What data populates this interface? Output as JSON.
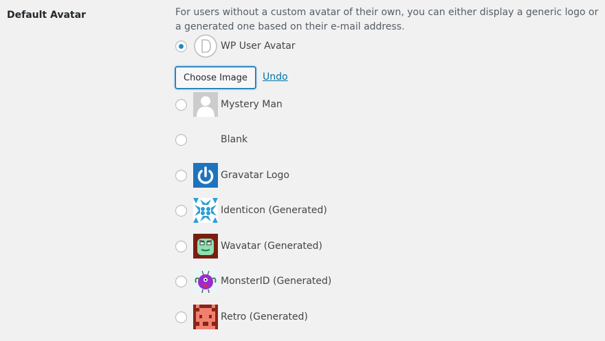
{
  "setting": {
    "label": "Default Avatar",
    "description": "For users without a custom avatar of their own, you can either display a generic logo or a generated one based on their e-mail address."
  },
  "actions": {
    "choose_image": "Choose Image",
    "undo": "Undo"
  },
  "options": [
    {
      "label": "WP User Avatar",
      "checked": true,
      "icon": "wp-user-avatar-icon"
    },
    {
      "label": "Mystery Man",
      "checked": false,
      "icon": "mystery-man-icon"
    },
    {
      "label": "Blank",
      "checked": false,
      "icon": "blank-avatar-icon"
    },
    {
      "label": "Gravatar Logo",
      "checked": false,
      "icon": "gravatar-logo-icon"
    },
    {
      "label": "Identicon (Generated)",
      "checked": false,
      "icon": "identicon-icon"
    },
    {
      "label": "Wavatar (Generated)",
      "checked": false,
      "icon": "wavatar-icon"
    },
    {
      "label": "MonsterID (Generated)",
      "checked": false,
      "icon": "monsterid-icon"
    },
    {
      "label": "Retro (Generated)",
      "checked": false,
      "icon": "retro-icon"
    }
  ],
  "colors": {
    "accent": "#1e8cbe",
    "link": "#0073aa",
    "gravatar_blue": "#1e73be",
    "identicon_blue": "#2a9fd6",
    "wavatar_bg": "#7a1e0f",
    "wavatar_face": "#8ee0b0",
    "monster_body": "#9b2bd0",
    "retro_bg": "#8a2515",
    "retro_fg": "#f08070"
  }
}
